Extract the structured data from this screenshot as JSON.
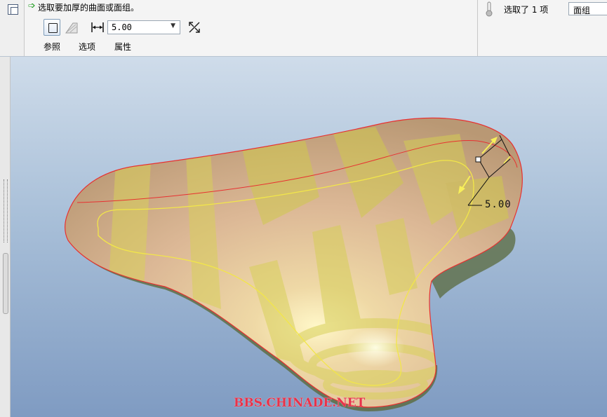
{
  "dashboard": {
    "prompt_text": "选取要加厚的曲面或面组。",
    "thickness_value": "5.00",
    "tabs": [
      {
        "label": "参照"
      },
      {
        "label": "选项"
      },
      {
        "label": "属性"
      }
    ]
  },
  "selection": {
    "count_text": "选取了 1 项",
    "filter_value": "面组"
  },
  "viewport": {
    "dimension_label": "5.00",
    "watermark": "BBS.CHINADE.NET"
  },
  "icons": {
    "feature": "thicken-feature-icon",
    "prompt": "green-arrow-icon",
    "side": "thicken-side-icon",
    "replace": "replace-surface-icon",
    "dim": "thickness-dimension-icon",
    "flip": "flip-direction-icon",
    "status": "thermometer-icon"
  },
  "colors": {
    "surface_edge": "#e83030",
    "yellow_curve": "#f2e64a",
    "viewport_top": "#cfdcea",
    "viewport_bottom": "#7f9bc2"
  }
}
